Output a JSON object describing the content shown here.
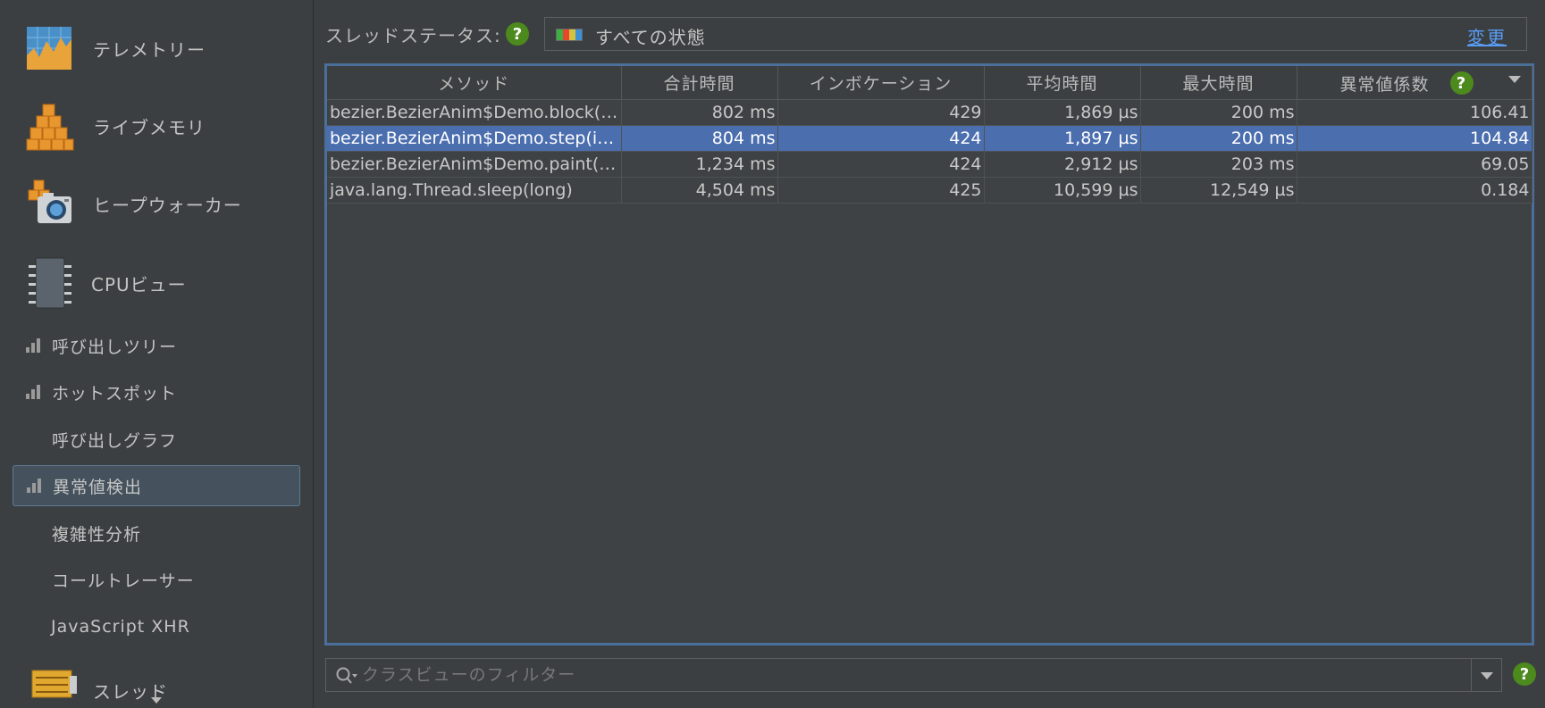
{
  "sidebar": {
    "big_items": [
      {
        "label": "テレメトリー",
        "icon": "telemetry-icon"
      },
      {
        "label": "ライブメモリ",
        "icon": "live-memory-icon"
      },
      {
        "label": "ヒープウォーカー",
        "icon": "heap-walker-icon"
      },
      {
        "label": "CPUビュー",
        "icon": "cpu-view-icon"
      }
    ],
    "sub_items": [
      {
        "label": "呼び出しツリー",
        "icon": "bar-chart-icon"
      },
      {
        "label": "ホットスポット",
        "icon": "bar-chart-icon"
      },
      {
        "label": "呼び出しグラフ"
      },
      {
        "label": "異常値検出",
        "icon": "bar-chart-icon",
        "selected": true
      },
      {
        "label": "複雑性分析"
      },
      {
        "label": "コールトレーサー"
      },
      {
        "label": "JavaScript XHR"
      }
    ],
    "partial_item": {
      "label": "スレッド",
      "icon": "threads-icon"
    }
  },
  "status": {
    "label": "スレッドステータス:",
    "help": "?",
    "value": "すべての状態",
    "change_link": "変更",
    "swatch_colors": [
      "#3cb043",
      "#e8442e",
      "#d6c33b",
      "#3d8fd6"
    ]
  },
  "table": {
    "columns": [
      "メソッド",
      "合計時間",
      "インボケーション",
      "平均時間",
      "最大時間",
      "異常値係数"
    ],
    "outlier_help": "?",
    "rows": [
      {
        "method": "bezier.BezierAnim$Demo.block(b...",
        "total": "802 ms",
        "invocations": "429",
        "avg": "1,869 µs",
        "max": "200 ms",
        "coefficient": "106.41"
      },
      {
        "method": "bezier.BezierAnim$Demo.step(int...",
        "total": "804 ms",
        "invocations": "424",
        "avg": "1,897 µs",
        "max": "200 ms",
        "coefficient": "104.84",
        "selected": true
      },
      {
        "method": "bezier.BezierAnim$Demo.paint(ja...",
        "total": "1,234 ms",
        "invocations": "424",
        "avg": "2,912 µs",
        "max": "203 ms",
        "coefficient": "69.05"
      },
      {
        "method": "java.lang.Thread.sleep(long)",
        "total": "4,504 ms",
        "invocations": "425",
        "avg": "10,599 µs",
        "max": "12,549 µs",
        "coefficient": "0.184"
      }
    ]
  },
  "filter": {
    "placeholder": "クラスビューのフィルター",
    "value": "",
    "help": "?"
  },
  "colors": {
    "selection": "#4b6eaf",
    "link": "#589df6",
    "help_badge": "#4d8a1d",
    "focus_border": "#4a6f9a"
  }
}
